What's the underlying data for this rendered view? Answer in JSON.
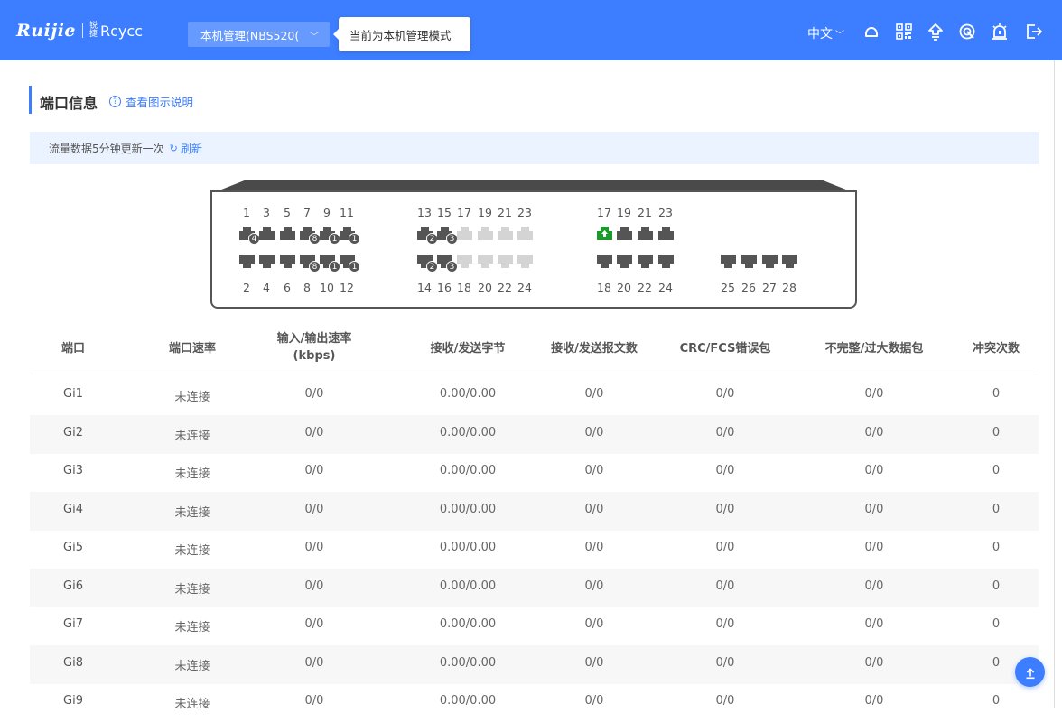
{
  "header": {
    "brand": "Ruijie",
    "sub_brand": "Rcycc",
    "sub_brand_mark": "锐捷",
    "mode_select": "本机管理(NBS520(",
    "mode_tooltip": "当前为本机管理模式",
    "language": "中文",
    "icons": [
      "cloud-icon",
      "qrcode-icon",
      "network-icon",
      "wireless-icon",
      "alert-icon",
      "logout-icon"
    ]
  },
  "section": {
    "title": "端口信息",
    "help_link": "查看图示说明"
  },
  "notice": {
    "text": "流量数据5分钟更新一次",
    "refresh": "刷新"
  },
  "switch_panel": {
    "top_labels_a": [
      "1",
      "3",
      "5",
      "7",
      "9",
      "11"
    ],
    "top_labels_b": [
      "13",
      "15",
      "17",
      "19",
      "21",
      "23"
    ],
    "top_labels_c": [
      "17",
      "19",
      "21",
      "23"
    ],
    "bottom_labels_a": [
      "2",
      "4",
      "6",
      "8",
      "10",
      "12"
    ],
    "bottom_labels_b": [
      "14",
      "16",
      "18",
      "20",
      "22",
      "24"
    ],
    "bottom_labels_c": [
      "18",
      "20",
      "22",
      "24"
    ],
    "bottom_labels_d": [
      "25",
      "26",
      "27",
      "28"
    ],
    "top_badges": [
      "4",
      "",
      "",
      "8",
      "1",
      "1",
      "2",
      "3"
    ],
    "bottom_badges": [
      "",
      "",
      "",
      "8",
      "1",
      "1",
      "2",
      "3"
    ],
    "colors": {
      "dark": "#555555",
      "disabled": "#d4d4d4",
      "up": "#1a9a29"
    }
  },
  "table": {
    "columns": [
      "端口",
      "端口速率",
      "输入/输出速率",
      "(kbps)",
      "接收/发送字节",
      "接收/发送报文数",
      "CRC/FCS错误包",
      "不完整/过大数据包",
      "冲突次数"
    ],
    "rows": [
      [
        "Gi1",
        "未连接",
        "0/0",
        "0.00/0.00",
        "0/0",
        "0/0",
        "0/0",
        "0"
      ],
      [
        "Gi2",
        "未连接",
        "0/0",
        "0.00/0.00",
        "0/0",
        "0/0",
        "0/0",
        "0"
      ],
      [
        "Gi3",
        "未连接",
        "0/0",
        "0.00/0.00",
        "0/0",
        "0/0",
        "0/0",
        "0"
      ],
      [
        "Gi4",
        "未连接",
        "0/0",
        "0.00/0.00",
        "0/0",
        "0/0",
        "0/0",
        "0"
      ],
      [
        "Gi5",
        "未连接",
        "0/0",
        "0.00/0.00",
        "0/0",
        "0/0",
        "0/0",
        "0"
      ],
      [
        "Gi6",
        "未连接",
        "0/0",
        "0.00/0.00",
        "0/0",
        "0/0",
        "0/0",
        "0"
      ],
      [
        "Gi7",
        "未连接",
        "0/0",
        "0.00/0.00",
        "0/0",
        "0/0",
        "0/0",
        "0"
      ],
      [
        "Gi8",
        "未连接",
        "0/0",
        "0.00/0.00",
        "0/0",
        "0/0",
        "0/0",
        "0"
      ],
      [
        "Gi9",
        "未连接",
        "0/0",
        "0.00/0.00",
        "0/0",
        "0/0",
        "0/0",
        "0"
      ]
    ]
  },
  "colors": {
    "accent": "#3c7eff",
    "notice_bg": "#eaf3ff"
  }
}
